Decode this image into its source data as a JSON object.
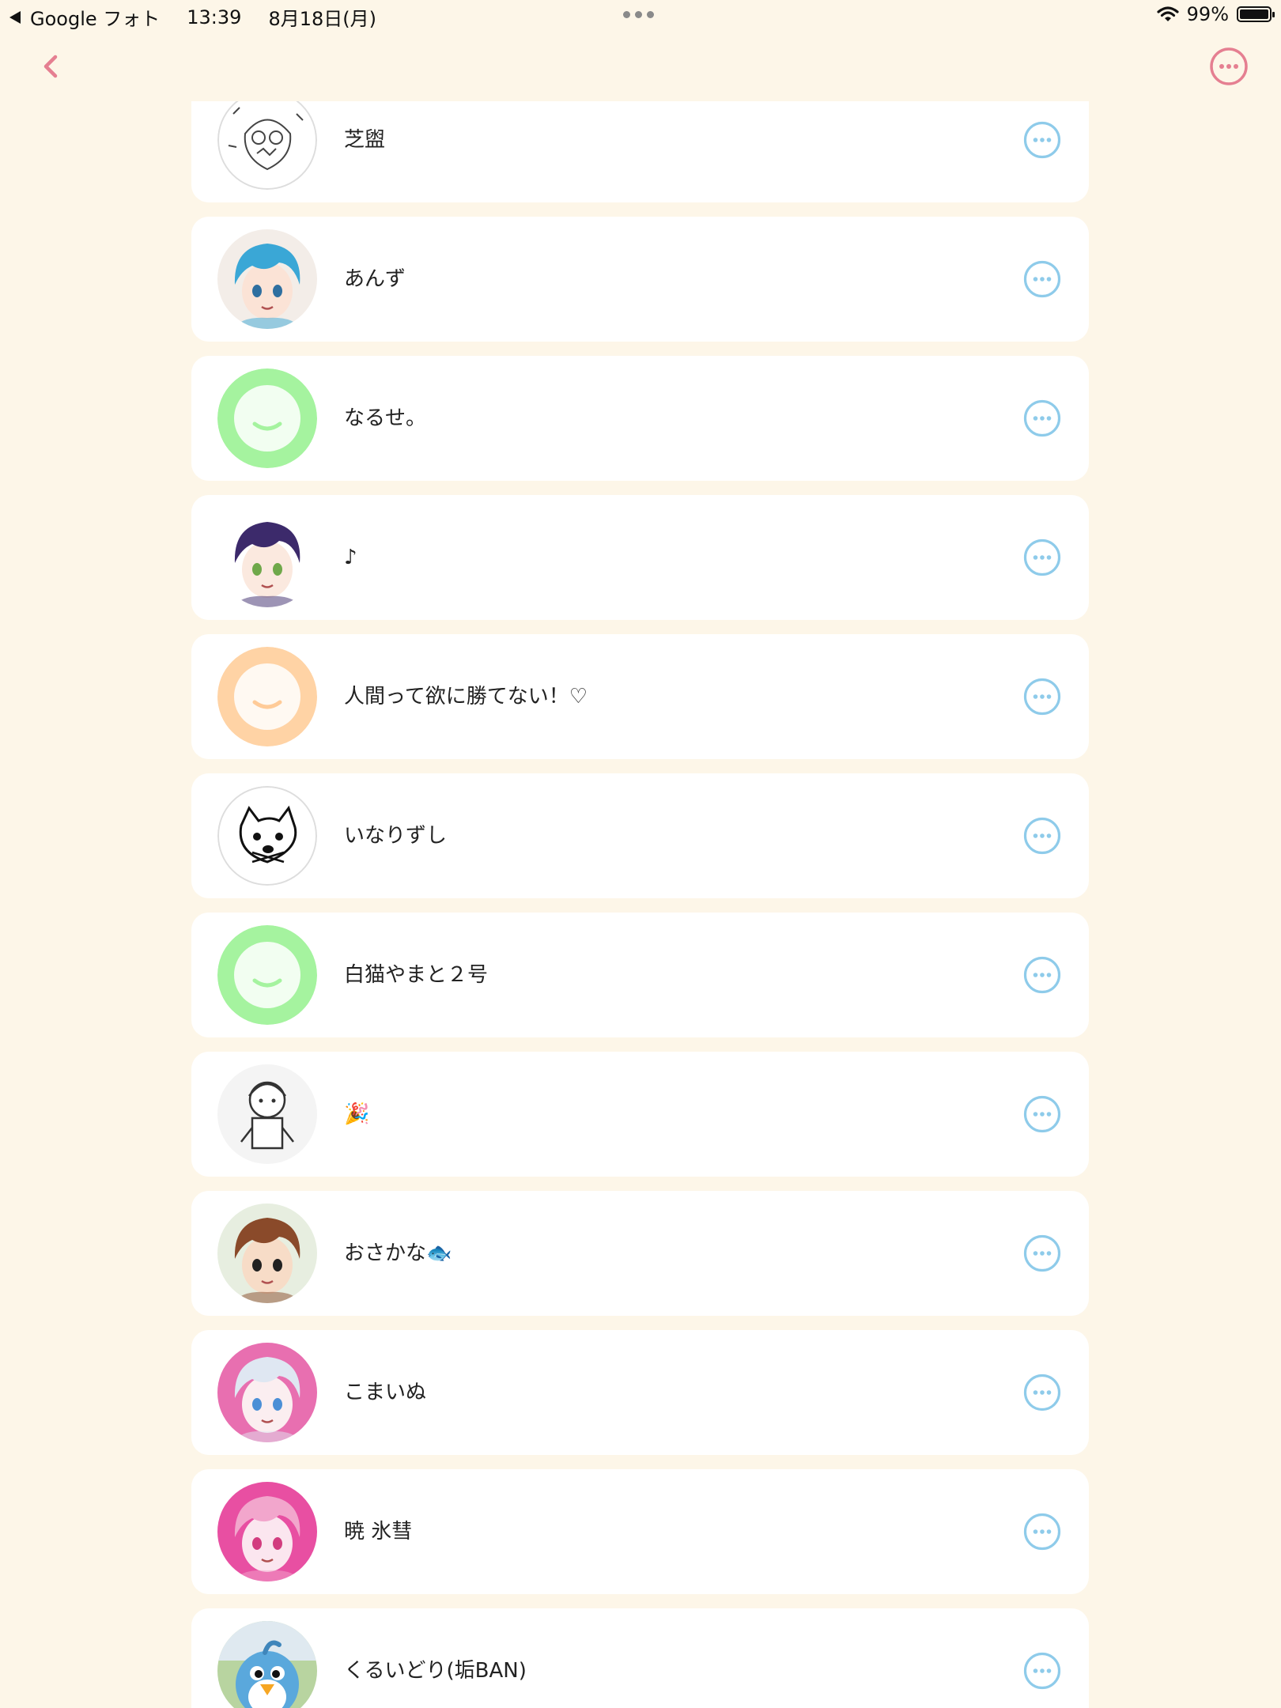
{
  "status_bar": {
    "back_app": "Google フォト",
    "time": "13:39",
    "date": "8月18日(月)",
    "battery": "99%",
    "battery_level": 0.99
  },
  "colors": {
    "background": "#fdf6e8",
    "accent_pink": "#e57f91",
    "more_blue": "#8ecbea",
    "card": "#ffffff"
  },
  "nav": {
    "back_icon": "chevron-left-icon",
    "menu_icon": "ellipsis-circle-icon"
  },
  "users": [
    {
      "name": "芝盥",
      "avatar": "sketch-face-avatar"
    },
    {
      "name": "あんず",
      "avatar": "blue-hair-anime-avatar"
    },
    {
      "name": "なるせ。",
      "avatar": "default-green-smile-avatar"
    },
    {
      "name": "♪",
      "avatar": "purple-hair-anime-avatar"
    },
    {
      "name": "人間って欲に勝てない！♡",
      "avatar": "default-orange-smile-avatar"
    },
    {
      "name": "いなりずし",
      "avatar": "cat-doodle-avatar"
    },
    {
      "name": "白猫やまと２号",
      "avatar": "default-green-smile-avatar"
    },
    {
      "name": "🎉",
      "avatar": "sketch-character-avatar"
    },
    {
      "name": "おさかな🐟",
      "avatar": "brown-hair-anime-avatar"
    },
    {
      "name": "こまいぬ",
      "avatar": "silver-hair-anime-avatar"
    },
    {
      "name": "暁 氷彗",
      "avatar": "pink-hair-anime-avatar"
    },
    {
      "name": "くるいどり(垢BAN)",
      "avatar": "blue-bird-avatar"
    }
  ]
}
